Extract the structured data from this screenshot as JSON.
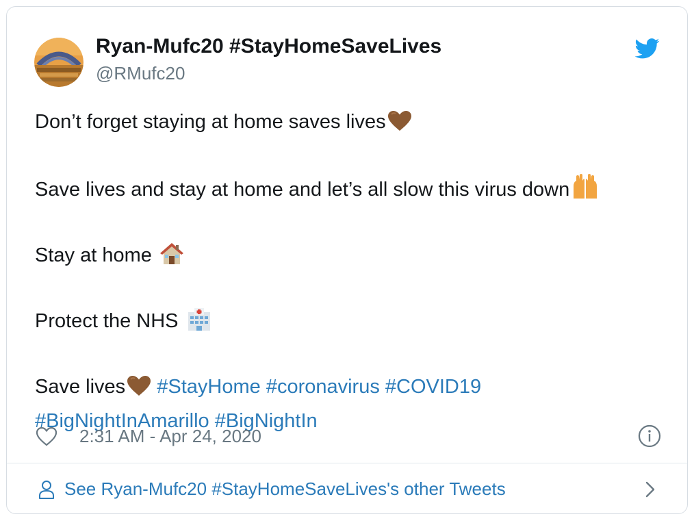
{
  "author": {
    "display_name": "Ryan-Mufc20 #StayHomeSaveLives",
    "handle": "@RMufc20"
  },
  "tweet": {
    "line1_text": "Don’t forget staying at home saves lives",
    "line2_text": "Save lives and stay at home and let’s all slow this virus down",
    "line3_text": "Stay at home ",
    "line4_text": "Protect the NHS ",
    "line5_text": "Save lives",
    "hashtags_line1": [
      "#StayHome",
      "#coronavirus",
      "#COVID19"
    ],
    "hashtags_line2": [
      "#BigNightInAmarillo",
      "#BigNightIn"
    ],
    "emojis": [
      "brown-heart",
      "raising-hands",
      "house",
      "hospital",
      "brown-heart"
    ]
  },
  "meta": {
    "timestamp": "2:31 AM - Apr 24, 2020",
    "like_icon": "heart-outline-icon",
    "info_icon": "info-icon"
  },
  "footer": {
    "link_text": "See Ryan-Mufc20 #StayHomeSaveLives's other Tweets",
    "user_icon": "user-icon",
    "chevron_icon": "chevron-right-icon"
  },
  "colors": {
    "text": "#14171a",
    "secondary": "#697882",
    "link": "#2b7bb9",
    "twitter_blue": "#1da1f2",
    "border": "#d7dde3"
  }
}
